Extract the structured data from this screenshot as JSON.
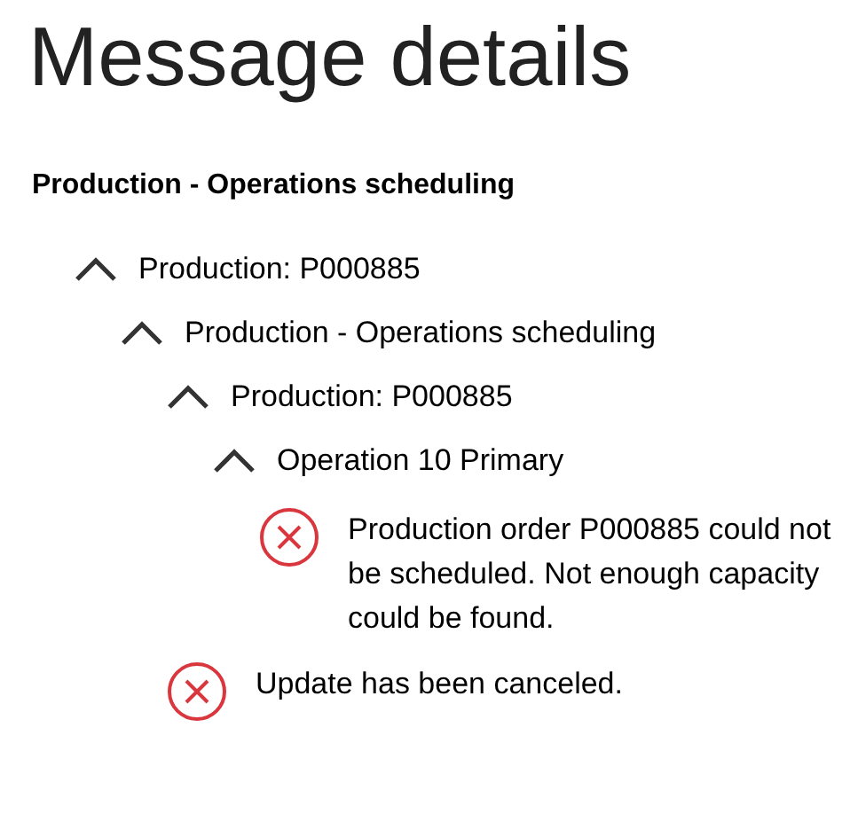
{
  "title": "Message details",
  "heading": "Production - Operations scheduling",
  "tree": [
    {
      "kind": "group",
      "label": "Production: P000885",
      "expanded": true,
      "children": [
        {
          "kind": "group",
          "label": "Production - Operations scheduling",
          "expanded": true,
          "children": [
            {
              "kind": "group",
              "label": "Production: P000885",
              "expanded": true,
              "children": [
                {
                  "kind": "group",
                  "label": "Operation 10 Primary",
                  "expanded": true,
                  "children": [
                    {
                      "kind": "error",
                      "text": "Production order P000885 could not be scheduled. Not enough capacity could be found."
                    }
                  ]
                }
              ]
            },
            {
              "kind": "error",
              "text": "Update has been canceled."
            }
          ]
        }
      ]
    }
  ]
}
